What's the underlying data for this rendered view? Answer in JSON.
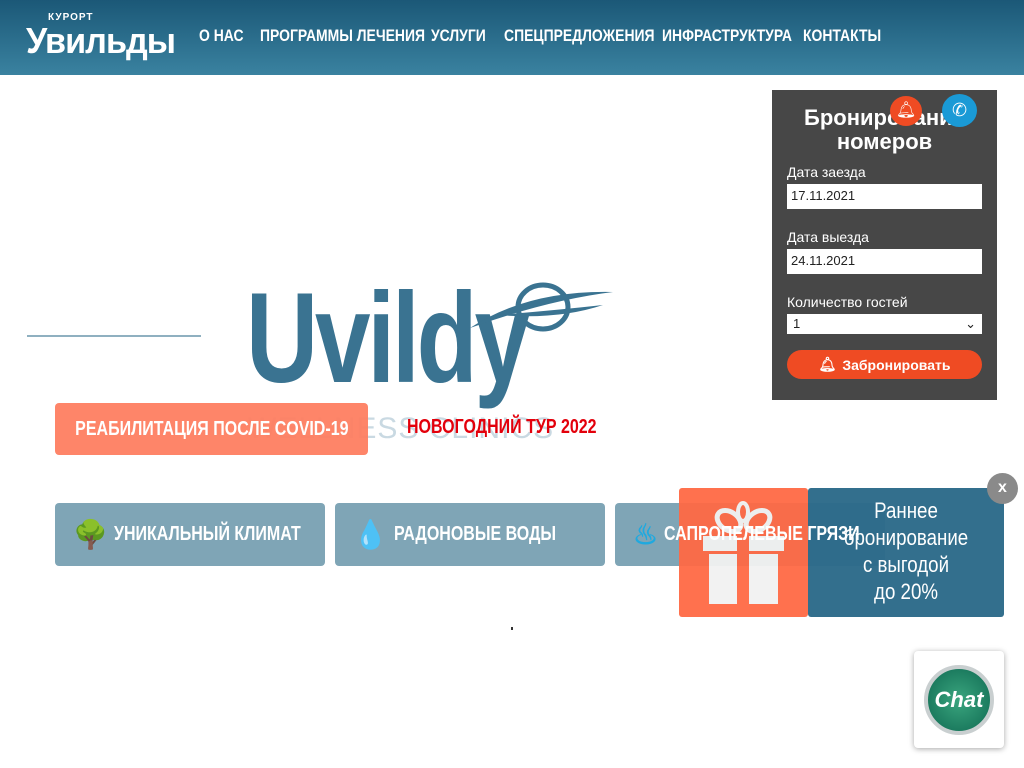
{
  "header": {
    "logo_small": "КУРОРТ",
    "logo_big": "Увильды",
    "nav": [
      "О НАС",
      "ПРОГРАММЫ ЛЕЧЕНИЯ",
      "УСЛУГИ",
      "СПЕЦПРЕДЛОЖЕНИЯ",
      "ИНФРАСТРУКТУРА",
      "КОНТАКТЫ"
    ]
  },
  "hero": {
    "logo_text": "Uvildy",
    "logo_sub": "WELLNESS CLINICS",
    "covid_button": "РЕАБИЛИТАЦИЯ ПОСЛЕ COVID-19",
    "ny_link": "НОВОГОДНИЙ ТУР 2022"
  },
  "features": [
    {
      "label": "УНИКАЛЬНЫЙ КЛИМАТ",
      "icon": "tree-icon"
    },
    {
      "label": "РАДОНОВЫЕ ВОДЫ",
      "icon": "drops-icon"
    },
    {
      "label": "САПРОПЕЛЕВЫЕ ГРЯЗИ",
      "icon": "mud-icon"
    }
  ],
  "booking": {
    "title": "Бронирование номеров",
    "checkin_label": "Дата заезда",
    "checkin": "17.11.2021",
    "checkout_label": "Дата выезда",
    "checkout": "24.11.2021",
    "guests_label": "Количество гостей",
    "guests": "1",
    "submit": "Забронировать"
  },
  "promo": {
    "lines": [
      "Раннее",
      "бронирование",
      "с выгодой",
      "до 20%"
    ],
    "close": "x"
  },
  "chat": {
    "label": "Chat"
  },
  "colors": {
    "header": "#1b5877",
    "accent": "#ef4b23",
    "promo_blue": "#2d6b8a",
    "feature": "#7fa5b6"
  }
}
